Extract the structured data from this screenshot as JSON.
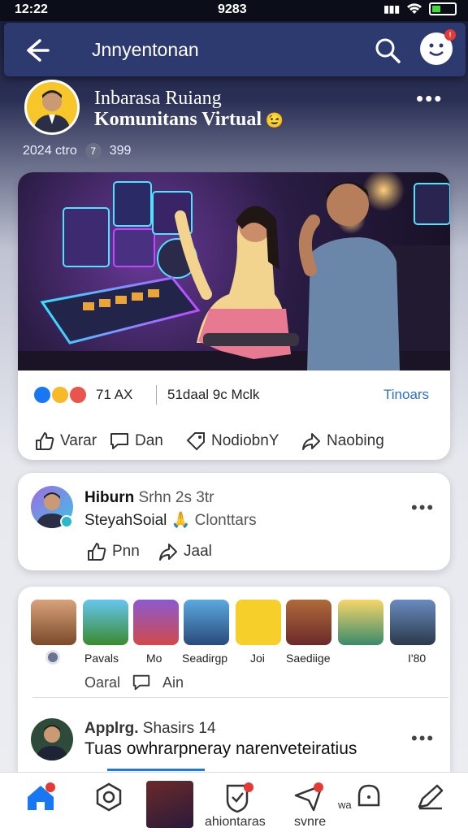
{
  "status": {
    "time_left": "12:22",
    "time_center": "9283"
  },
  "topbar": {
    "title": "Jnnyentonan"
  },
  "post": {
    "title_line1": "Inbarasa Ruiang",
    "title_line2": "Komunitans Virtual",
    "date": "2024 ctro",
    "comments": "7",
    "views": "399",
    "reactions_count": "71 AX",
    "shares_text": "51daal 9c Mclk",
    "more_link": "Tinoars",
    "actions": [
      "Varar",
      "Dan",
      "NodiobnY",
      "Naobing"
    ]
  },
  "card2": {
    "name": "Hiburn",
    "meta": "Srhn 2s 3tr",
    "subtitle": "SteyahSoial",
    "subtitle2": "Clonttars",
    "actions": [
      "Pnn",
      "Jaal"
    ]
  },
  "stories": {
    "labels": [
      "Pavals",
      "Mo",
      "Seadirgp",
      "Joi",
      "Saediige",
      "",
      "",
      "I'80"
    ],
    "row2": [
      "Oaral",
      "Ain"
    ]
  },
  "post2": {
    "name": "Applrg.",
    "name2": "Shasirs 14",
    "text": "Tuas owhrarpneray narenveteiratius"
  },
  "bottom_nav": {
    "label1": "ahiontaras",
    "label2": "svnre",
    "label3": "wa"
  },
  "colors": {
    "topbar": "#2d3a70",
    "accent": "#1877f2",
    "badge": "#e53935"
  }
}
